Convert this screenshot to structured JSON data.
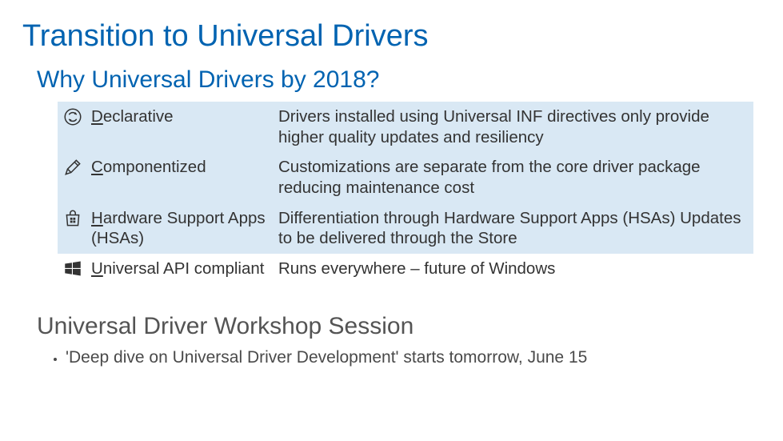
{
  "title": "Transition to Universal Drivers",
  "section1": {
    "heading": "Why Universal Drivers by 2018?",
    "rows": [
      {
        "icon": "refresh-circle-icon",
        "term_first": "D",
        "term_rest": "eclarative",
        "desc": "Drivers installed using Universal INF directives only provide higher quality updates and resiliency",
        "highlight": true
      },
      {
        "icon": "pen-icon",
        "term_first": "C",
        "term_rest": "omponentized",
        "desc": "Customizations are separate from the core driver package reducing maintenance cost",
        "highlight": true
      },
      {
        "icon": "store-bag-icon",
        "term_first": "H",
        "term_rest": "ardware Support Apps (HSAs)",
        "desc": "Differentiation through Hardware Support Apps (HSAs) Updates to be delivered through the Store",
        "highlight": true
      },
      {
        "icon": "windows-tiles-icon",
        "term_first": "U",
        "term_rest": "niversal API compliant",
        "desc": "Runs everywhere – future of Windows",
        "highlight": false
      }
    ]
  },
  "section2": {
    "heading": "Universal Driver Workshop Session",
    "bullets": [
      "'Deep dive on Universal Driver Development' starts tomorrow, June 15"
    ]
  }
}
